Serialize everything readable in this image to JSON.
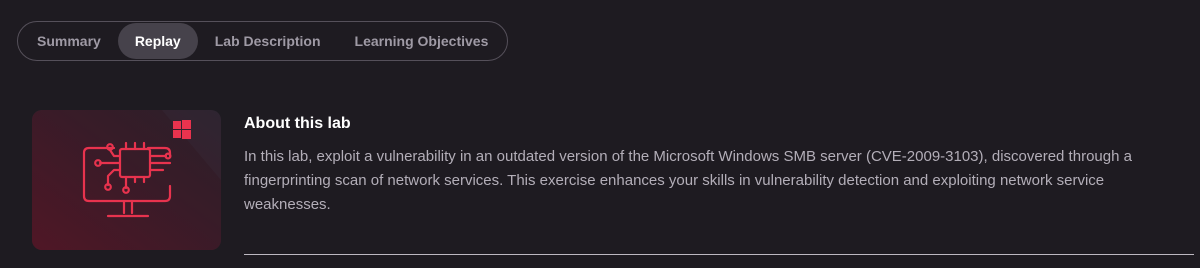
{
  "tabs": [
    {
      "label": "Summary",
      "active": false
    },
    {
      "label": "Replay",
      "active": true
    },
    {
      "label": "Lab Description",
      "active": false
    },
    {
      "label": "Learning Objectives",
      "active": false
    }
  ],
  "about": {
    "title": "About this lab",
    "description": "In this lab, exploit a vulnerability in an outdated version of the Microsoft Windows SMB server (CVE-2009-3103), discovered through a fingerprinting scan of network services. This exercise enhances your skills in vulnerability detection and exploiting network service weaknesses."
  },
  "lab_icon": {
    "icon": "monitor-circuit-chip-icon",
    "badge": "windows-logo-icon",
    "accent_color": "#e8334e"
  },
  "colors": {
    "background": "#1e1b21",
    "tab_active_bg": "#46424b",
    "tab_text": "#9f9aa5",
    "text_muted": "#b3aeb8",
    "accent": "#e8334e"
  }
}
